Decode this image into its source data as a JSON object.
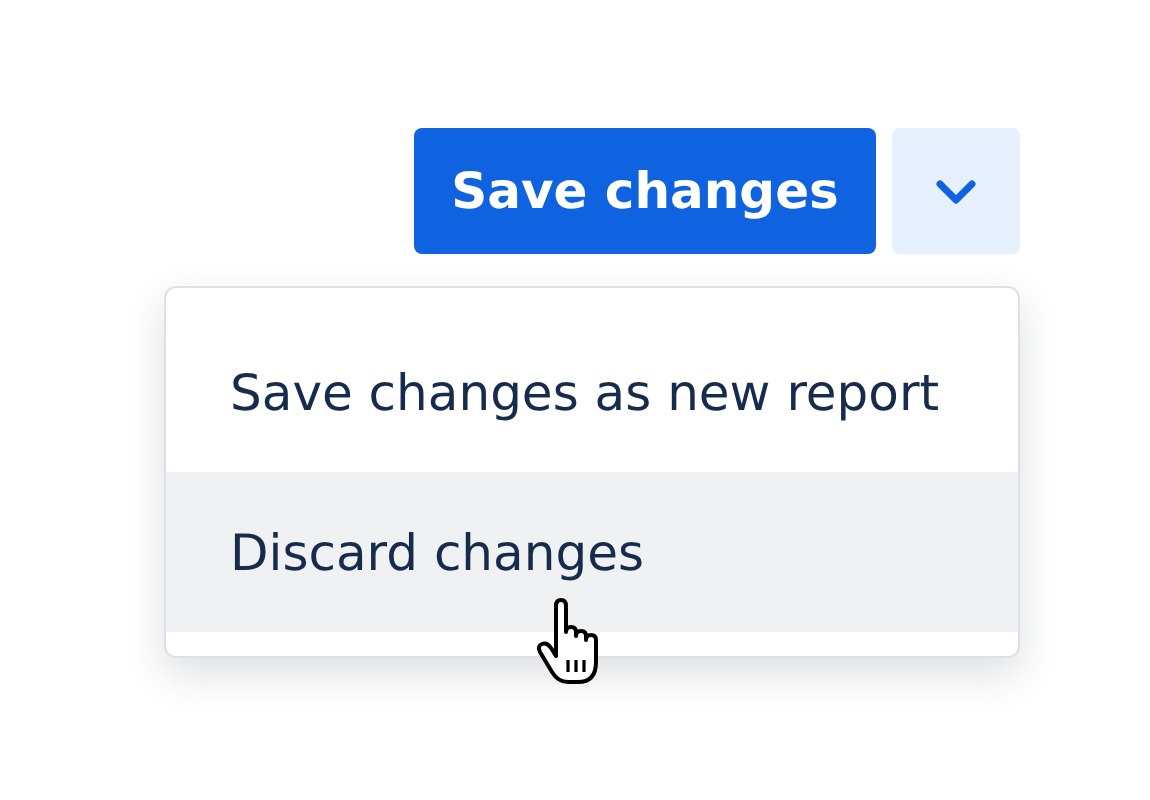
{
  "save_button": {
    "label": "Save changes"
  },
  "menu_toggle": {
    "expanded": true
  },
  "menu_items": [
    {
      "label": "Save changes as new report",
      "hovered": false
    },
    {
      "label": "Discard changes",
      "hovered": true
    }
  ]
}
